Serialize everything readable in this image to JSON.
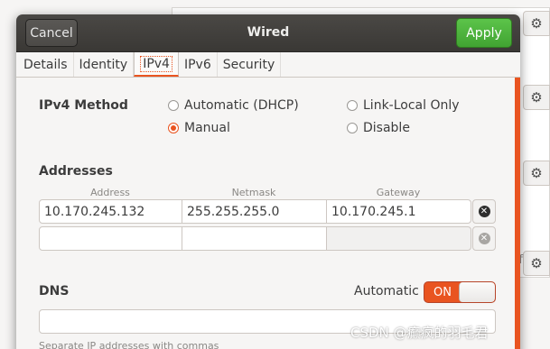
{
  "dialog": {
    "title": "Wired",
    "cancel_label": "Cancel",
    "apply_label": "Apply"
  },
  "tabs": [
    {
      "label": "Details",
      "active": false
    },
    {
      "label": "Identity",
      "active": false
    },
    {
      "label": "IPv4",
      "active": true
    },
    {
      "label": "IPv6",
      "active": false
    },
    {
      "label": "Security",
      "active": false
    }
  ],
  "ipv4": {
    "method_label": "IPv4 Method",
    "options": [
      {
        "label": "Automatic (DHCP)",
        "checked": false
      },
      {
        "label": "Link-Local Only",
        "checked": false
      },
      {
        "label": "Manual",
        "checked": true
      },
      {
        "label": "Disable",
        "checked": false
      }
    ]
  },
  "addresses": {
    "label": "Addresses",
    "columns": [
      "Address",
      "Netmask",
      "Gateway"
    ],
    "rows": [
      {
        "address": "10.170.245.132",
        "netmask": "255.255.255.0",
        "gateway": "10.170.245.1"
      },
      {
        "address": "",
        "netmask": "",
        "gateway": ""
      }
    ]
  },
  "dns": {
    "label": "DNS",
    "automatic_label": "Automatic",
    "toggle_label": "ON",
    "toggle_on": true,
    "value": "",
    "hint": "Separate IP addresses with commas"
  },
  "background": {
    "off_label": "ff",
    "gear_icon": "gear-icon"
  },
  "watermark": "CSDN @癫疯的羽毛君",
  "colors": {
    "accent": "#e95420",
    "apply": "#4caf3a",
    "headerbar": "#3f3d3a"
  }
}
